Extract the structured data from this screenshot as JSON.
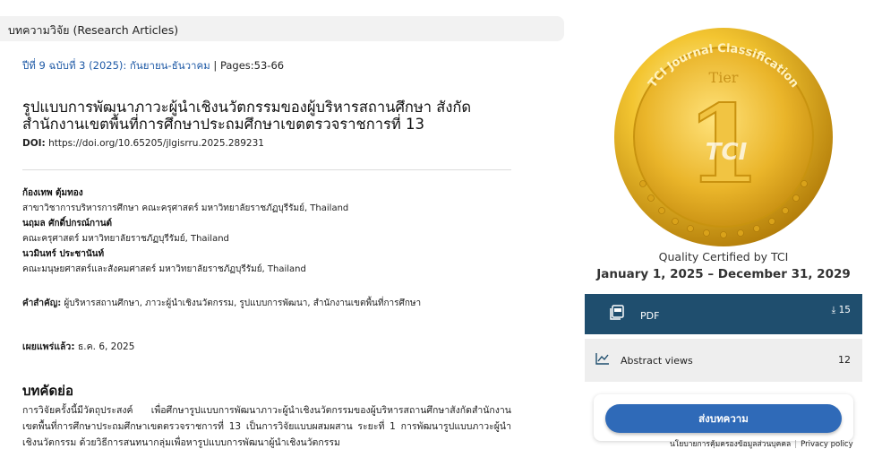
{
  "section": {
    "label": "บทความวิจัย (Research Articles)"
  },
  "issue": {
    "link_text": "ปีที่ 9 ฉบับที่ 3 (2025): กันยายน-ธันวาคม",
    "separator": " | ",
    "pages": "Pages:53-66"
  },
  "article": {
    "title": "รูปแบบการพัฒนาภาวะผู้นำเชิงนวัตกรรมของผู้บริหารสถานศึกษา สังกัดสำนักงานเขตพื้นที่การศึกษาประถมศึกษาเขตตรวจราชการที่ 13",
    "doi_label": "DOI:",
    "doi_value": " https://doi.org/10.65205/jlgisrru.2025.289231"
  },
  "authors": [
    {
      "name": "ก้องเทพ ตุ้มทอง",
      "affiliation": "สาขาวิชาการบริหารการศึกษา คณะครุศาสตร์ มหาวิทยาลัยราชภัฏบุรีรัมย์, Thailand"
    },
    {
      "name": "นฤมล ศักดิ์ปกรณ์กานต์",
      "affiliation": "คณะครุศาสตร์ มหาวิทยาลัยราชภัฏบุรีรัมย์, Thailand"
    },
    {
      "name": "นวมินทร์ ประชานันท์",
      "affiliation": "คณะมนุษยศาสตร์และสังคมศาสตร์ มหาวิทยาลัยราชภัฏบุรีรัมย์, Thailand"
    }
  ],
  "keywords": {
    "label": "คำสำคัญ:",
    "value": " ผู้บริหารสถานศึกษา, ภาวะผู้นำเชิงนวัตกรรม, รูปแบบการพัฒนา, สำนักงานเขตพื้นที่การศึกษา"
  },
  "published": {
    "label": "เผยแพร่แล้ว:",
    "value": " ธ.ค. 6, 2025"
  },
  "abstract": {
    "heading": "บทคัดย่อ",
    "body": "การวิจัยครั้งนี้มีวัตถุประสงค์ เพื่อศึกษารูปแบบการพัฒนาภาวะผู้นำเชิงนวัตกรรมของผู้บริหารสถานศึกษาสังกัดสำนักงานเขตพื้นที่การศึกษาประถมศึกษาเขตตรวจราชการที่ 13 เป็นการวิจัยแบบผสมผสาน ระยะที่ 1 การพัฒนารูปแบบภาวะผู้นำเชิงนวัตกรรม ด้วยวิธีการสนทนากลุ่มเพื่อหารูปแบบการพัฒนาผู้นำเชิงนวัตกรรม"
  },
  "tci": {
    "badge_ring_text": "TCI Journal Classification",
    "badge_tier_text": "Tier",
    "badge_number": "1",
    "badge_logo_text": "TCI",
    "quality_text": "Quality Certified by TCI",
    "dates": "January 1, 2025 – December 31, 2029"
  },
  "pdf": {
    "label": "PDF",
    "count": "15",
    "icon": "pdf-file-icon",
    "download_icon": "download-icon"
  },
  "views": {
    "label": "Abstract views",
    "count": "12",
    "icon": "line-chart-icon"
  },
  "submit": {
    "label": "ส่งบทความ"
  },
  "footer": {
    "privacy_th": "นโยบายการคุ้มครองข้อมูลส่วนบุคคล",
    "privacy_en": "Privacy policy"
  },
  "colors": {
    "pdf_panel": "#1f4e6e",
    "submit_button": "#2f6ab8",
    "link": "#1f5aa6",
    "gold": "#e8b923"
  }
}
